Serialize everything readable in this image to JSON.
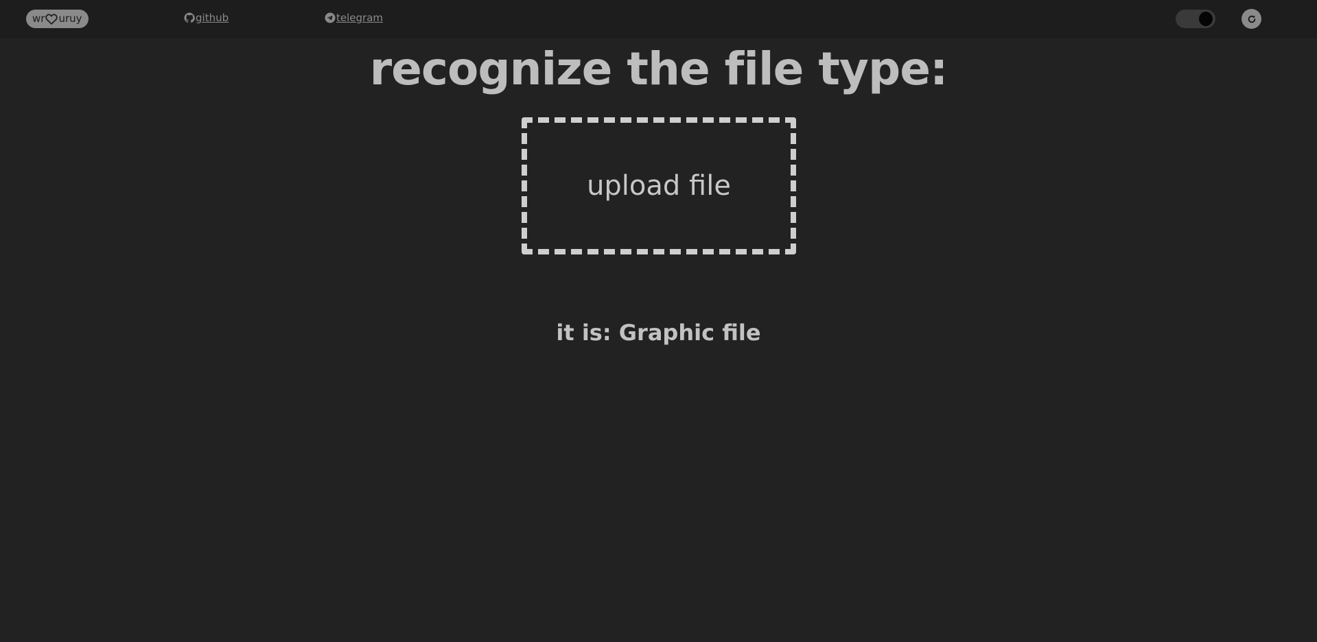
{
  "header": {
    "brand": {
      "prefix": "wr",
      "icon": "heart-icon",
      "suffix": "uruy"
    },
    "links": [
      {
        "icon": "github-icon",
        "label": "github"
      },
      {
        "icon": "telegram-icon",
        "label": "telegram"
      }
    ],
    "theme_toggle": {
      "state": "dark"
    },
    "refresh": {
      "icon": "refresh-icon"
    }
  },
  "main": {
    "title": "recognize the file type:",
    "upload_label": "upload file",
    "result_label": "it is:",
    "result_value": "Graphic file"
  },
  "colors": {
    "background": "#222222",
    "header": "#1d1d1d",
    "text": "#bdbdbd",
    "muted": "#8a8a8a",
    "dashed_border": "#cfcfcf"
  }
}
